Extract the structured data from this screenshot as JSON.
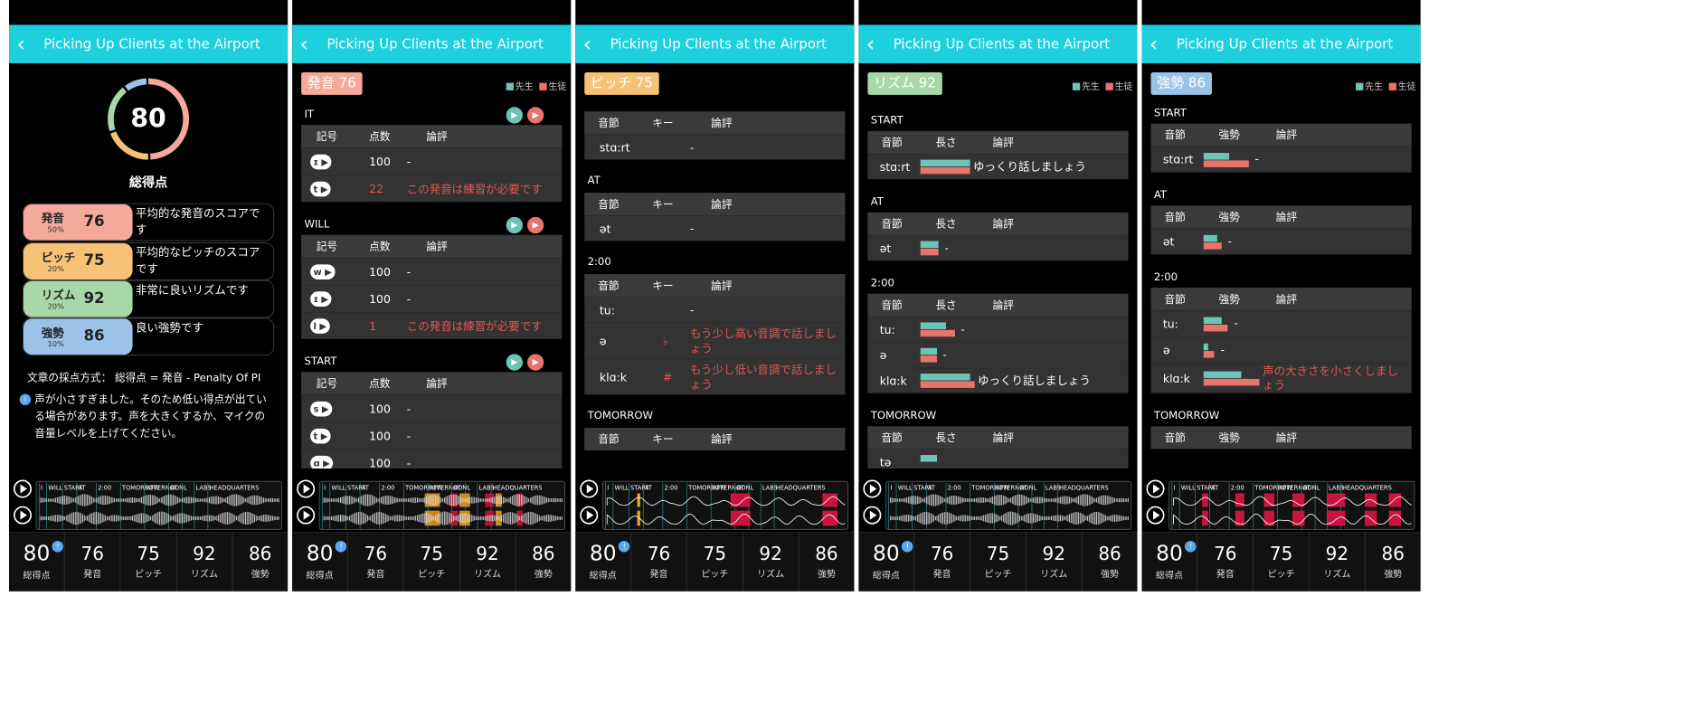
{
  "header_title": "Picking Up Clients at the Airport",
  "tabs": [
    {
      "value": "80",
      "label": "総得点"
    },
    {
      "value": "76",
      "label": "発音"
    },
    {
      "value": "75",
      "label": "ピッチ"
    },
    {
      "value": "92",
      "label": "リズム"
    },
    {
      "value": "86",
      "label": "強勢"
    }
  ],
  "legend": {
    "teacher": "先生",
    "student": "生徒",
    "teacher_color": "#6ec3b7",
    "student_color": "#e8746c"
  },
  "wave_labels": [
    "I",
    "WILL",
    "START",
    "AT",
    "2:00",
    "TOMORROW",
    "AFTERNOON",
    "AT",
    "L",
    "LABS",
    "HEADQUARTERS"
  ],
  "summary": {
    "total_score": "80",
    "total_label": "総得点",
    "categories": [
      {
        "name": "発音",
        "score": "76",
        "weight": "50%",
        "comment": "平均的な発音のスコアです",
        "color": "#f4a99a"
      },
      {
        "name": "ピッチ",
        "score": "75",
        "weight": "20%",
        "comment": "平均的なピッチのスコアです",
        "color": "#f6c275"
      },
      {
        "name": "リズム",
        "score": "92",
        "weight": "20%",
        "comment": "非常に良いリズムです",
        "color": "#a9d8a8"
      },
      {
        "name": "強勢",
        "score": "86",
        "weight": "10%",
        "comment": "良い強勢です",
        "color": "#9cc2e8"
      }
    ],
    "method": "文章の採点方式： 総得点 = 発音 - Penalty Of PI",
    "note": "声が小さすぎました。そのため低い得点が出ている場合があります。声を大きくするか、マイクの音量レベルを上げてください。",
    "note_icon": "info-icon"
  },
  "pronunciation": {
    "badge": "発音 76",
    "cols": [
      "記号",
      "点数",
      "論評"
    ],
    "sections": [
      {
        "word": "IT",
        "rows": [
          {
            "sym": "ɪ",
            "score": "100",
            "comment": "-",
            "bad": false
          },
          {
            "sym": "t",
            "score": "22",
            "comment": "この発音は練習が必要です",
            "bad": true
          }
        ]
      },
      {
        "word": "WILL",
        "rows": [
          {
            "sym": "w",
            "score": "100",
            "comment": "-",
            "bad": false
          },
          {
            "sym": "ɪ",
            "score": "100",
            "comment": "-",
            "bad": false
          },
          {
            "sym": "l",
            "score": "1",
            "comment": "この発音は練習が必要です",
            "bad": true
          }
        ]
      },
      {
        "word": "START",
        "rows": [
          {
            "sym": "s",
            "score": "100",
            "comment": "-",
            "bad": false
          },
          {
            "sym": "t",
            "score": "100",
            "comment": "-",
            "bad": false
          },
          {
            "sym": "ɑ",
            "score": "100",
            "comment": "-",
            "bad": false
          }
        ]
      }
    ]
  },
  "pitch": {
    "badge": "ピッチ 75",
    "cols": [
      "音節",
      "キー",
      "論評"
    ],
    "sections": [
      {
        "word": "",
        "rows": [
          {
            "syl": "stɑ:rt",
            "key": "",
            "comment": "-"
          }
        ]
      },
      {
        "word": "AT",
        "rows": [
          {
            "syl": "ət",
            "key": "",
            "comment": "-"
          }
        ]
      },
      {
        "word": "2:00",
        "rows": [
          {
            "syl": "tu:",
            "key": "",
            "comment": "-"
          },
          {
            "syl": "ə",
            "key": "♭",
            "comment": "もう少し高い音調で話しましょう"
          },
          {
            "syl": "klɑ:k",
            "key": "#",
            "comment": "もう少し低い音調で話しましょう"
          }
        ]
      },
      {
        "word": "TOMORROW",
        "rows": []
      }
    ]
  },
  "rhythm": {
    "badge": "リズム 92",
    "cols": [
      "音節",
      "長さ",
      "論評"
    ],
    "sections": [
      {
        "word": "START",
        "rows": [
          {
            "syl": "stɑ:rt",
            "t": 0.55,
            "s": 0.55,
            "comment": "ゆっくり話しましょう"
          }
        ]
      },
      {
        "word": "AT",
        "rows": [
          {
            "syl": "ət",
            "t": 0.2,
            "s": 0.2,
            "comment": "-"
          }
        ]
      },
      {
        "word": "2:00",
        "rows": [
          {
            "syl": "tu:",
            "t": 0.28,
            "s": 0.38,
            "comment": "-"
          },
          {
            "syl": "ə",
            "t": 0.18,
            "s": 0.18,
            "comment": "-"
          },
          {
            "syl": "klɑ:k",
            "t": 0.55,
            "s": 0.6,
            "comment": "ゆっくり話しましょう"
          }
        ]
      },
      {
        "word": "TOMORROW",
        "rows": [
          {
            "syl": "tə",
            "t": 0.18,
            "s": 0,
            "comment": ""
          }
        ]
      }
    ]
  },
  "stress": {
    "badge": "強勢 86",
    "cols": [
      "音節",
      "強勢",
      "論評"
    ],
    "sections": [
      {
        "word": "START",
        "rows": [
          {
            "syl": "stɑ:rt",
            "t": 0.28,
            "s": 0.5,
            "comment": "-"
          }
        ]
      },
      {
        "word": "AT",
        "rows": [
          {
            "syl": "ət",
            "t": 0.15,
            "s": 0.2,
            "comment": "-"
          }
        ]
      },
      {
        "word": "2:00",
        "rows": [
          {
            "syl": "tu:",
            "t": 0.2,
            "s": 0.27,
            "comment": "-"
          },
          {
            "syl": "ə",
            "t": 0.05,
            "s": 0.12,
            "comment": "-"
          },
          {
            "syl": "klɑ:k",
            "t": 0.42,
            "s": 0.62,
            "comment": "声の大きさを小さくしましょう"
          }
        ]
      },
      {
        "word": "TOMORROW",
        "rows": []
      }
    ]
  }
}
